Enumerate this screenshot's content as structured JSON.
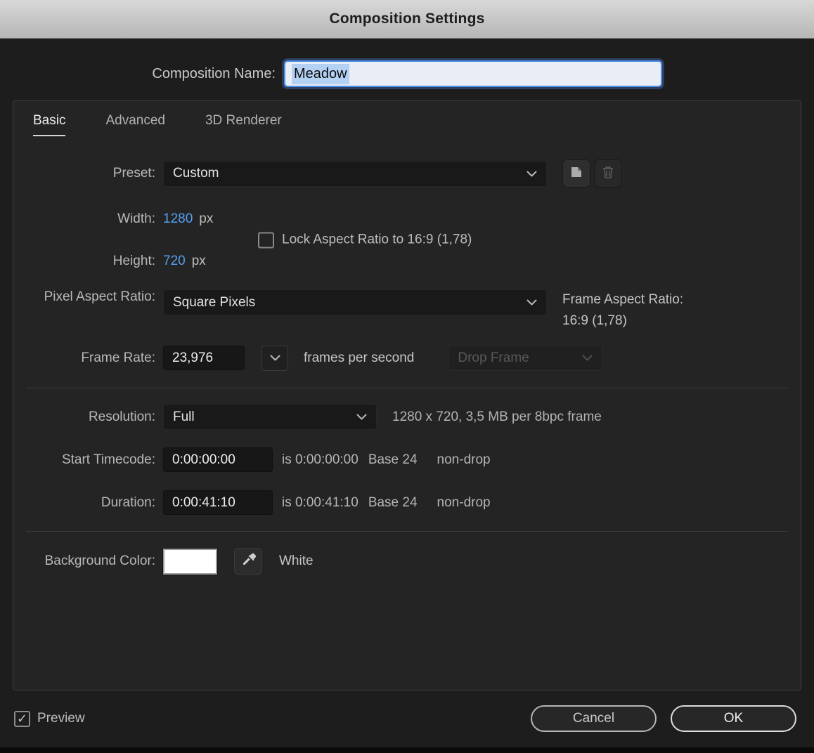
{
  "dialog": {
    "title": "Composition Settings"
  },
  "name": {
    "label": "Composition Name:",
    "value": "Meadow"
  },
  "tabs": {
    "basic": "Basic",
    "advanced": "Advanced",
    "renderer": "3D Renderer"
  },
  "preset": {
    "label": "Preset:",
    "value": "Custom"
  },
  "size": {
    "width_label": "Width:",
    "width_value": "1280",
    "width_unit": "px",
    "height_label": "Height:",
    "height_value": "720",
    "height_unit": "px",
    "lock_label": "Lock Aspect Ratio to 16:9 (1,78)"
  },
  "par": {
    "label": "Pixel Aspect Ratio:",
    "value": "Square Pixels"
  },
  "far": {
    "label": "Frame Aspect Ratio:",
    "value": "16:9 (1,78)"
  },
  "frame_rate": {
    "label": "Frame Rate:",
    "value": "23,976",
    "suffix": "frames per second",
    "drop_frame": "Drop Frame"
  },
  "resolution": {
    "label": "Resolution:",
    "value": "Full",
    "info": "1280 x 720, 3,5 MB per 8bpc frame"
  },
  "start_timecode": {
    "label": "Start Timecode:",
    "value": "0:00:00:00",
    "is": "is 0:00:00:00",
    "base": "Base 24",
    "drop": "non-drop"
  },
  "duration": {
    "label": "Duration:",
    "value": "0:00:41:10",
    "is": "is 0:00:41:10",
    "base": "Base 24",
    "drop": "non-drop"
  },
  "background": {
    "label": "Background Color:",
    "color_name": "White",
    "swatch_color": "#ffffff"
  },
  "footer": {
    "preview": "Preview",
    "cancel": "Cancel",
    "ok": "OK"
  },
  "icons": {
    "checkmark": "✓"
  },
  "colors": {
    "value_blue": "#55a0f2",
    "focus_blue": "#4e8de9",
    "titlebar_text": "#1e1e1e"
  }
}
